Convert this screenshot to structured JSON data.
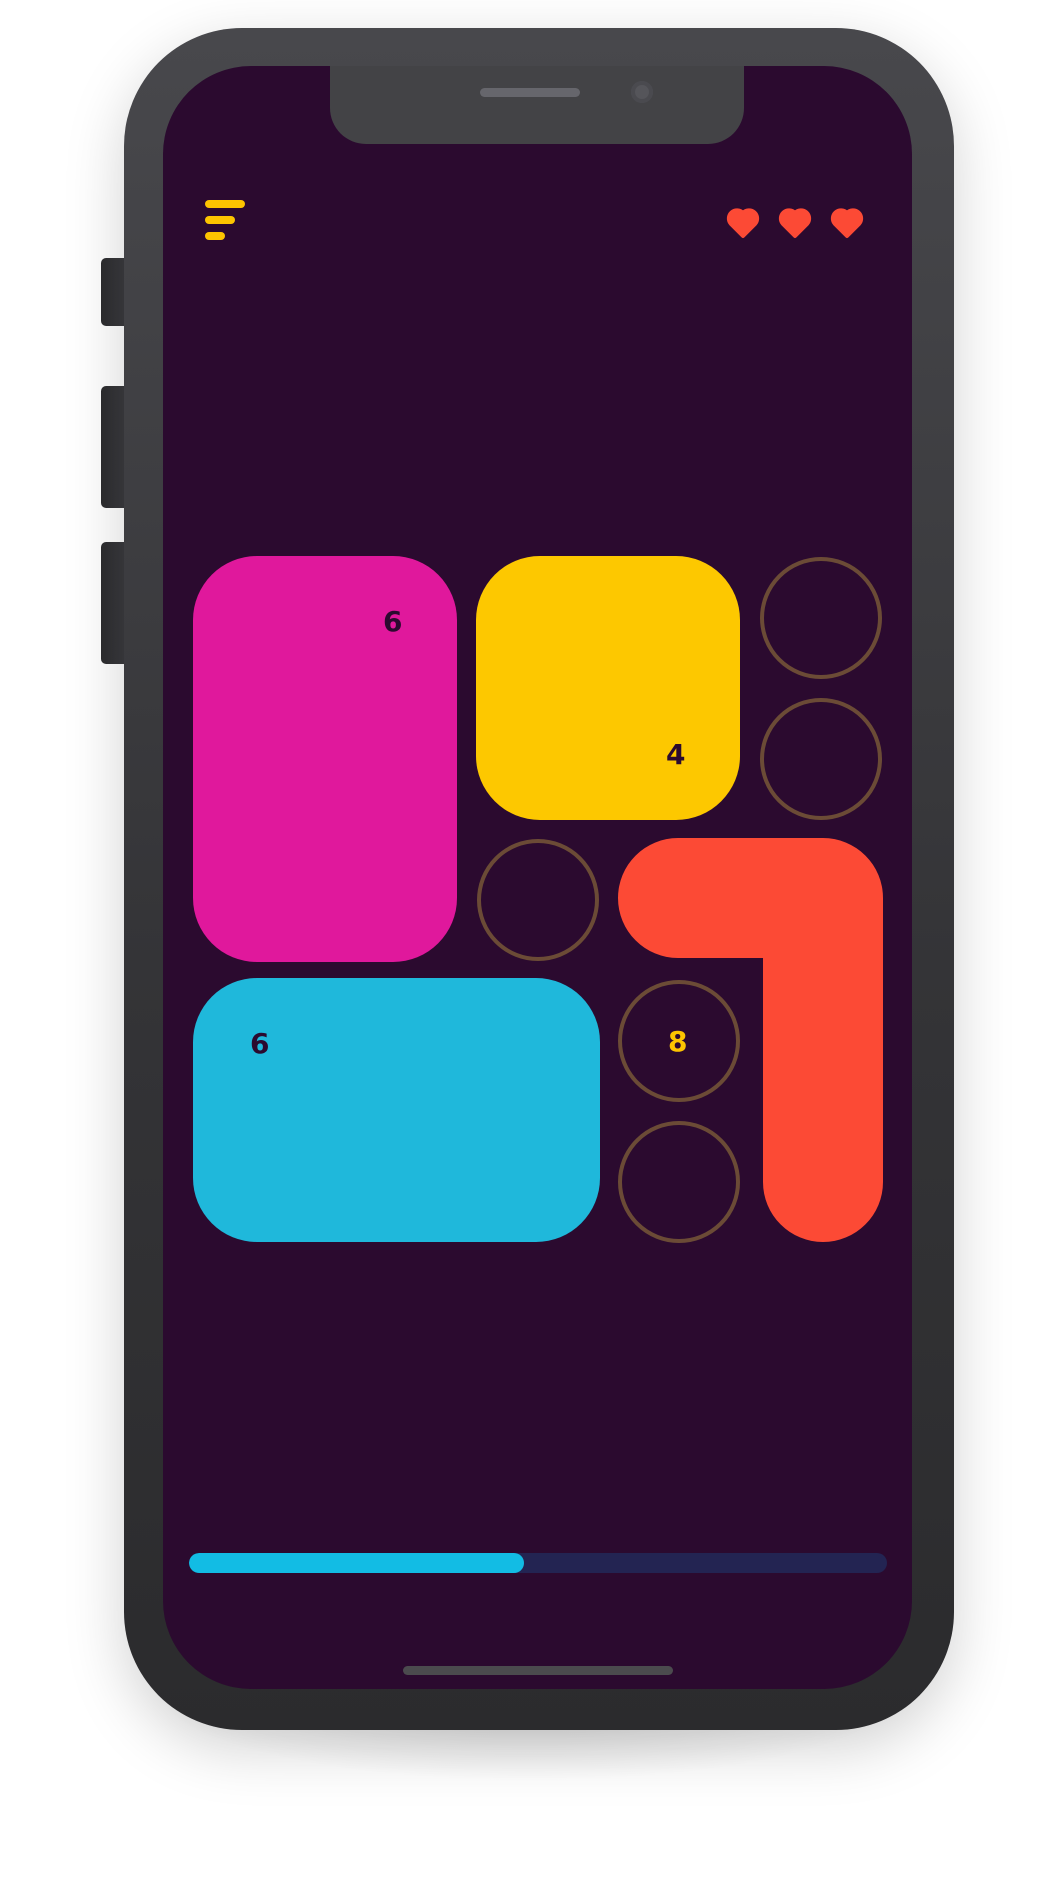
{
  "header": {
    "menu_icon": "menu-icon",
    "lives_icon": "heart-icon",
    "lives_count": 3,
    "accent_color": "#fcc400",
    "heart_color": "#fc4a35"
  },
  "board": {
    "blocks": [
      {
        "name": "magenta-block",
        "color": "#e0189c",
        "label": "6"
      },
      {
        "name": "yellow-block",
        "color": "#fdc800",
        "label": "4"
      },
      {
        "name": "cyan-block",
        "color": "#1fb8db",
        "label": "6"
      },
      {
        "name": "red-l-block",
        "color": "#fc4a35",
        "label": ""
      }
    ],
    "slots": [
      {
        "label": ""
      },
      {
        "label": ""
      },
      {
        "label": ""
      },
      {
        "label": "8"
      },
      {
        "label": ""
      }
    ],
    "background_color": "#2b0a2f",
    "slot_color": "#6b4b36"
  },
  "progress": {
    "fraction": 0.48,
    "fill_color": "#12bce4",
    "track_color": "#232452"
  }
}
